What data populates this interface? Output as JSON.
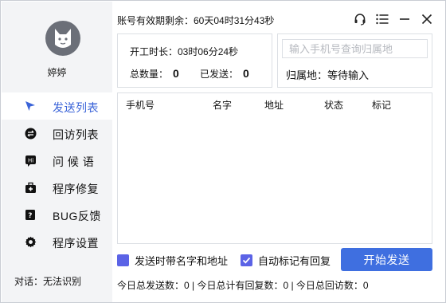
{
  "user": {
    "name": "婷婷"
  },
  "header": {
    "account_remaining": "账号有效期剩余：60天04时31分43秒"
  },
  "window_controls": [
    {
      "name": "headset-icon"
    },
    {
      "name": "menu-icon"
    },
    {
      "name": "minimize-icon"
    },
    {
      "name": "close-icon"
    }
  ],
  "sidebar": {
    "items": [
      {
        "label": "发送列表",
        "icon": "send-cursor-icon",
        "active": true
      },
      {
        "label": "回访列表",
        "icon": "revisit-icon",
        "active": false
      },
      {
        "label": "问 候 语",
        "icon": "greeting-icon",
        "active": false
      },
      {
        "label": "程序修复",
        "icon": "repair-kit-icon",
        "active": false
      },
      {
        "label": "BUG反馈",
        "icon": "bug-feedback-icon",
        "active": false
      },
      {
        "label": "程序设置",
        "icon": "gear-icon",
        "active": false
      }
    ],
    "dialog_status": "对话：无法识别"
  },
  "stats": {
    "work_time": "开工时长：03时06分24秒",
    "total_label": "总数量：",
    "total_value": "0",
    "sent_label": "已发送：",
    "sent_value": "0"
  },
  "lookup": {
    "placeholder": "输入手机号查询归属地",
    "result": "归属地：等待输入"
  },
  "table": {
    "columns": [
      "手机号",
      "名字",
      "地址",
      "状态",
      "标记"
    ]
  },
  "options": {
    "send_with_name_address": "发送时带名字和地址",
    "auto_mark_replied": "自动标记有回复"
  },
  "actions": {
    "start_send": "开始发送"
  },
  "footer": {
    "stats": "今日总发送数：0 | 今日总计有回复数：0 | 今日总回访数：0"
  },
  "colors": {
    "accent": "#3f6fe0",
    "checkbox": "#5b63e6",
    "active_nav_text": "#3a63d8",
    "sidebar_bg": "#f3f4f6"
  }
}
